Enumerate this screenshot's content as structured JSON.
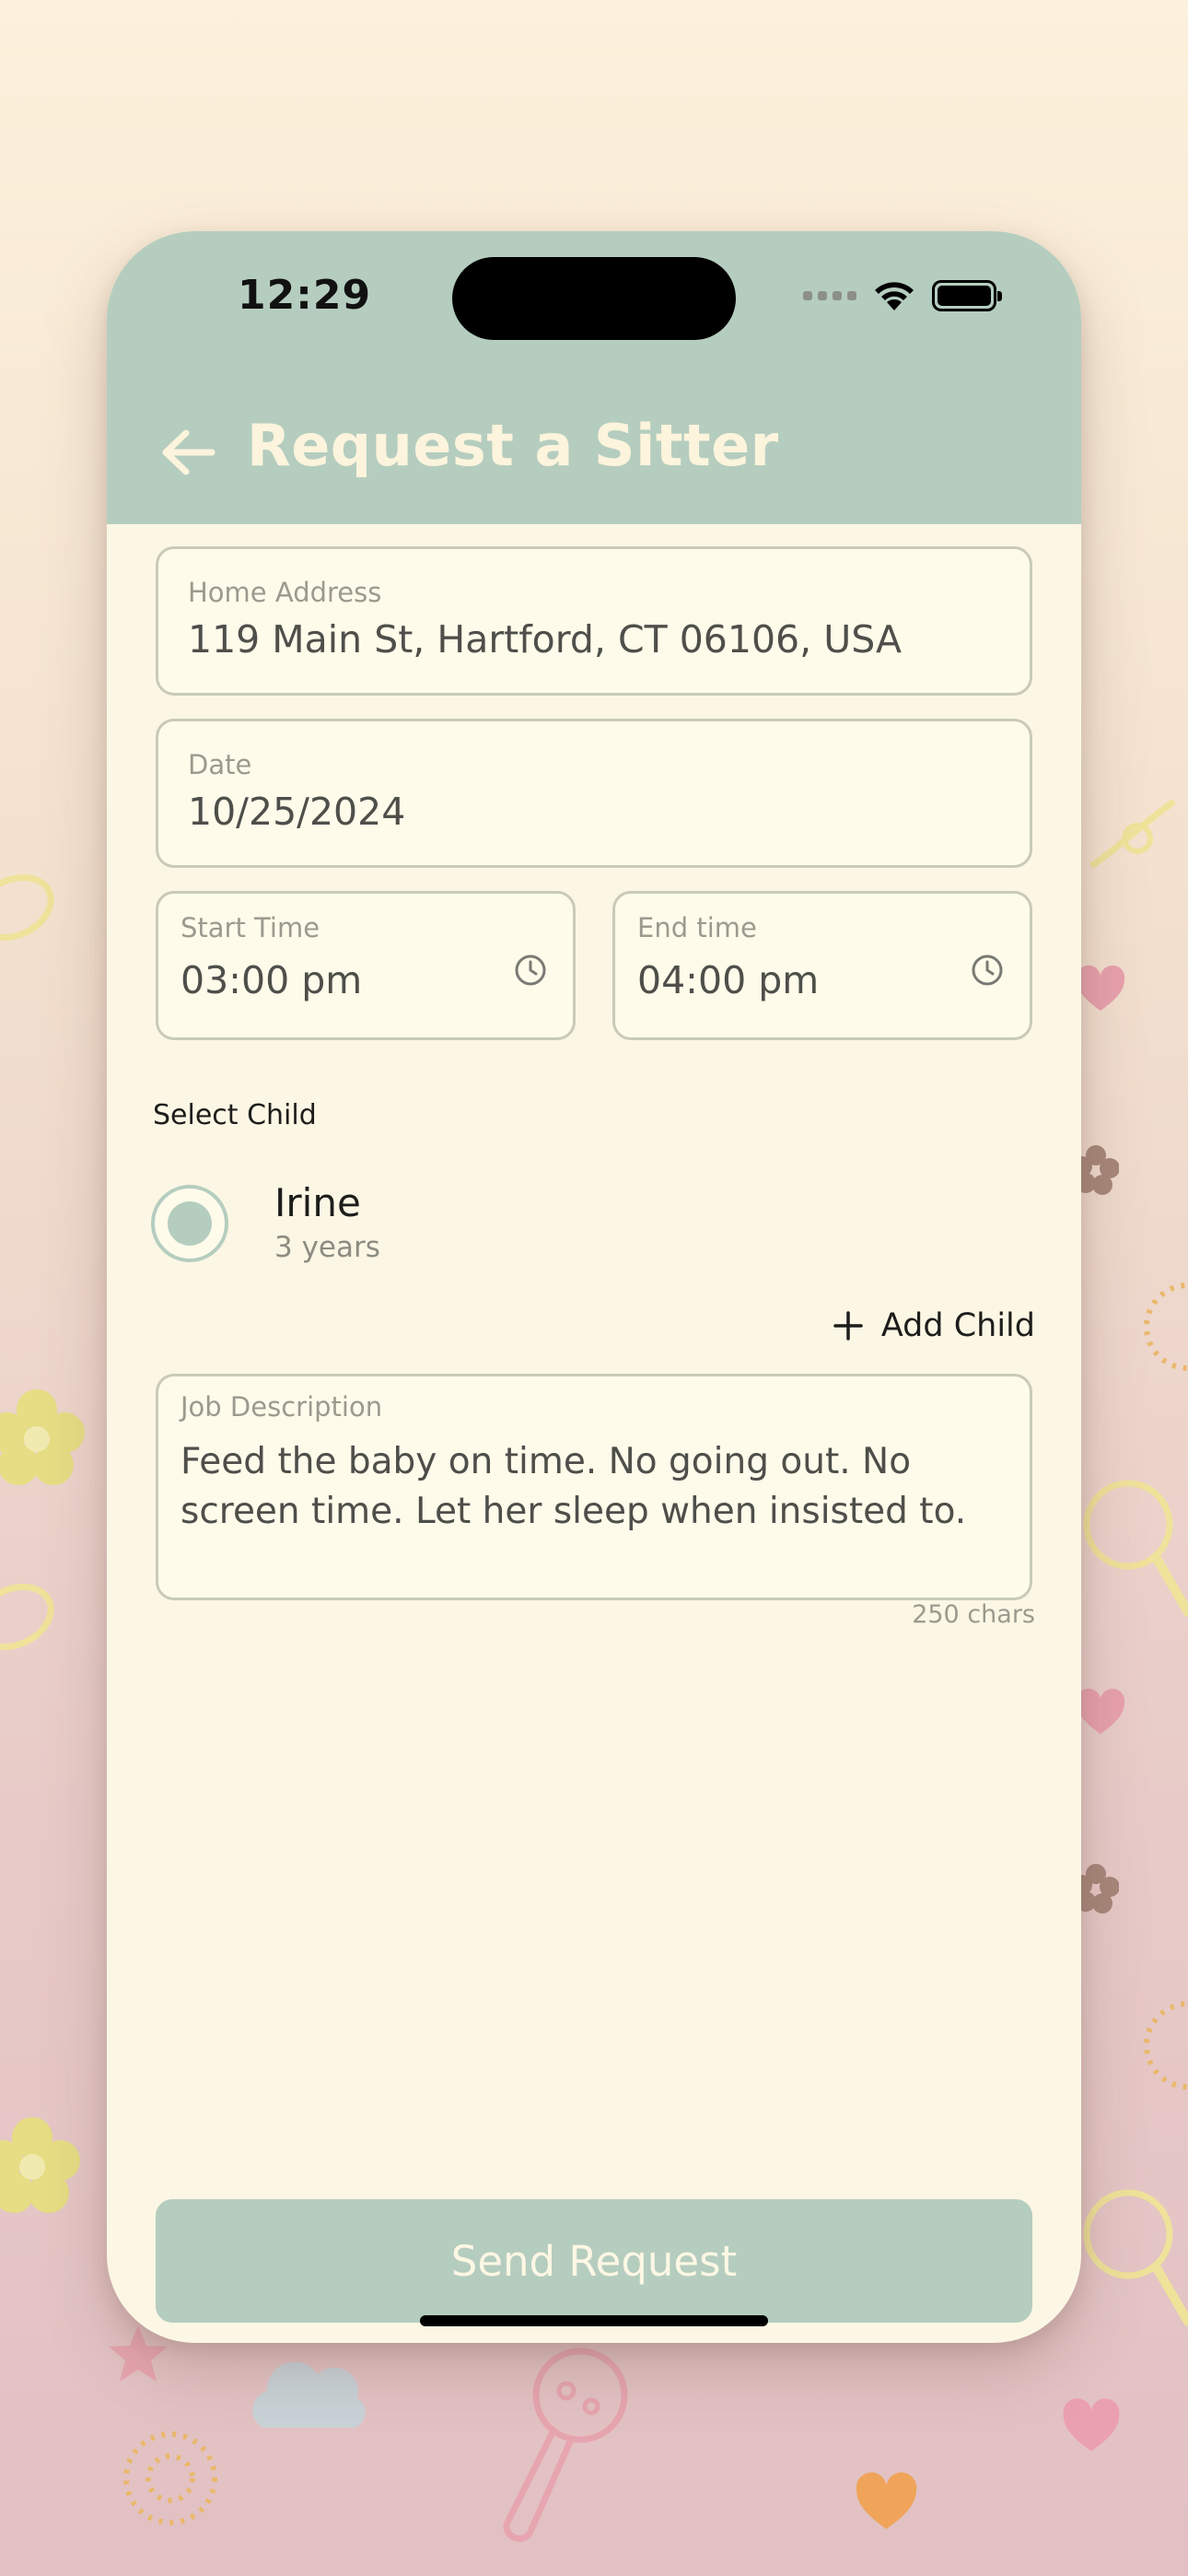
{
  "colors": {
    "header": "#b5cdbf",
    "page_background": "#fcf7e4",
    "field_background": "#fefbea",
    "field_border": "#c9cab8",
    "title_text": "#fcf4dc",
    "accent": "#b5cdbf"
  },
  "status_bar": {
    "time": "12:29",
    "icons": [
      "signal-dots-icon",
      "wifi-icon",
      "battery-icon"
    ]
  },
  "header": {
    "back_icon": "arrow-left-icon",
    "title": "Request a Sitter"
  },
  "form": {
    "home_address": {
      "label": "Home Address",
      "value": "119 Main St, Hartford, CT 06106, USA"
    },
    "date": {
      "label": "Date",
      "value": "10/25/2024"
    },
    "start_time": {
      "label": "Start Time",
      "value": "03:00 pm",
      "icon": "clock-icon"
    },
    "end_time": {
      "label": "End time",
      "value": "04:00 pm",
      "icon": "clock-icon"
    },
    "select_child": {
      "label": "Select Child",
      "children": [
        {
          "name": "Irine",
          "age": "3 years",
          "selected": true
        }
      ],
      "add_child_label": "Add Child",
      "add_icon": "plus-icon"
    },
    "job_description": {
      "label": "Job Description",
      "value": "Feed the baby on time. No going out. No screen time. Let her sleep when insisted to.",
      "char_count": "250 chars"
    }
  },
  "actions": {
    "send_label": "Send Request"
  }
}
